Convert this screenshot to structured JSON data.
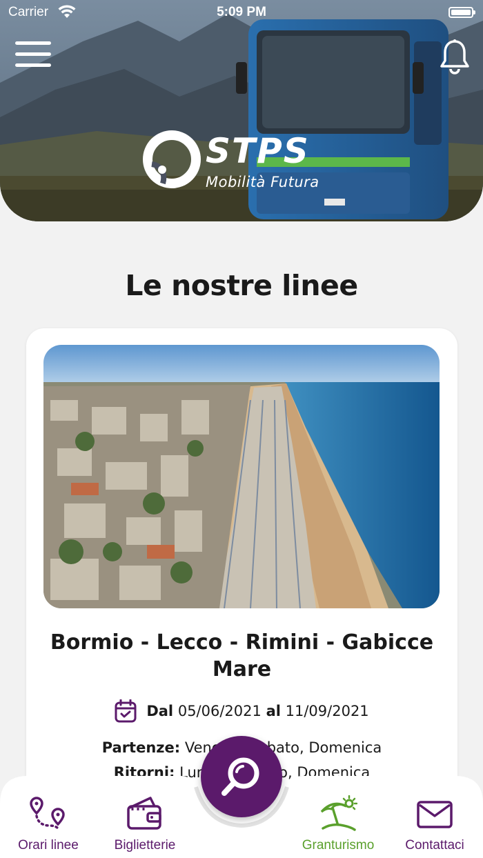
{
  "status_bar": {
    "carrier": "Carrier",
    "time": "5:09 PM"
  },
  "header": {
    "logo_text": "STPS",
    "logo_tagline": "Mobilità Futura"
  },
  "main": {
    "section_title": "Le nostre linee",
    "card": {
      "title": "Bormio - Lecco - Rimini - Gabicce Mare",
      "dates": {
        "from_label": "Dal",
        "from_date": "05/06/2021",
        "to_label": "al",
        "to_date": "11/09/2021"
      },
      "departures_label": "Partenze:",
      "departures_value": "Venerdì, Sabato, Domenica",
      "returns_label": "Ritorni:",
      "returns_value": "Lunedì, Sabato, Domenica"
    }
  },
  "bottom_nav": {
    "items": [
      {
        "label": "Orari linee",
        "icon": "route-pins-icon"
      },
      {
        "label": "Biglietterie",
        "icon": "wallet-icon"
      },
      {
        "label": "Granturismo",
        "icon": "beach-umbrella-icon",
        "active": true
      },
      {
        "label": "Contattaci",
        "icon": "envelope-icon"
      }
    ],
    "search_icon": "search-icon"
  },
  "colors": {
    "brand_purple": "#5b1a6b",
    "active_green": "#5aa02c",
    "background": "#f2f2f2"
  }
}
